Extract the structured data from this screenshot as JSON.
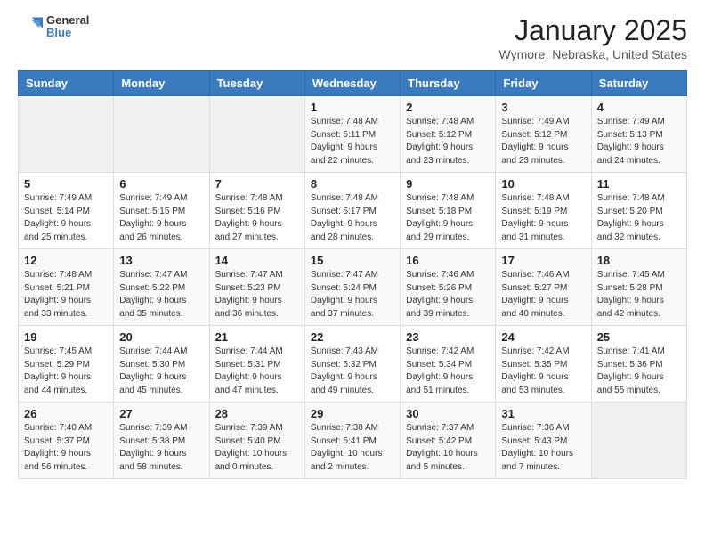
{
  "header": {
    "logo_line1": "General",
    "logo_line2": "Blue",
    "title": "January 2025",
    "subtitle": "Wymore, Nebraska, United States"
  },
  "weekdays": [
    "Sunday",
    "Monday",
    "Tuesday",
    "Wednesday",
    "Thursday",
    "Friday",
    "Saturday"
  ],
  "weeks": [
    [
      {
        "day": "",
        "info": ""
      },
      {
        "day": "",
        "info": ""
      },
      {
        "day": "",
        "info": ""
      },
      {
        "day": "1",
        "info": "Sunrise: 7:48 AM\nSunset: 5:11 PM\nDaylight: 9 hours and 22 minutes."
      },
      {
        "day": "2",
        "info": "Sunrise: 7:48 AM\nSunset: 5:12 PM\nDaylight: 9 hours and 23 minutes."
      },
      {
        "day": "3",
        "info": "Sunrise: 7:49 AM\nSunset: 5:12 PM\nDaylight: 9 hours and 23 minutes."
      },
      {
        "day": "4",
        "info": "Sunrise: 7:49 AM\nSunset: 5:13 PM\nDaylight: 9 hours and 24 minutes."
      }
    ],
    [
      {
        "day": "5",
        "info": "Sunrise: 7:49 AM\nSunset: 5:14 PM\nDaylight: 9 hours and 25 minutes."
      },
      {
        "day": "6",
        "info": "Sunrise: 7:49 AM\nSunset: 5:15 PM\nDaylight: 9 hours and 26 minutes."
      },
      {
        "day": "7",
        "info": "Sunrise: 7:48 AM\nSunset: 5:16 PM\nDaylight: 9 hours and 27 minutes."
      },
      {
        "day": "8",
        "info": "Sunrise: 7:48 AM\nSunset: 5:17 PM\nDaylight: 9 hours and 28 minutes."
      },
      {
        "day": "9",
        "info": "Sunrise: 7:48 AM\nSunset: 5:18 PM\nDaylight: 9 hours and 29 minutes."
      },
      {
        "day": "10",
        "info": "Sunrise: 7:48 AM\nSunset: 5:19 PM\nDaylight: 9 hours and 31 minutes."
      },
      {
        "day": "11",
        "info": "Sunrise: 7:48 AM\nSunset: 5:20 PM\nDaylight: 9 hours and 32 minutes."
      }
    ],
    [
      {
        "day": "12",
        "info": "Sunrise: 7:48 AM\nSunset: 5:21 PM\nDaylight: 9 hours and 33 minutes."
      },
      {
        "day": "13",
        "info": "Sunrise: 7:47 AM\nSunset: 5:22 PM\nDaylight: 9 hours and 35 minutes."
      },
      {
        "day": "14",
        "info": "Sunrise: 7:47 AM\nSunset: 5:23 PM\nDaylight: 9 hours and 36 minutes."
      },
      {
        "day": "15",
        "info": "Sunrise: 7:47 AM\nSunset: 5:24 PM\nDaylight: 9 hours and 37 minutes."
      },
      {
        "day": "16",
        "info": "Sunrise: 7:46 AM\nSunset: 5:26 PM\nDaylight: 9 hours and 39 minutes."
      },
      {
        "day": "17",
        "info": "Sunrise: 7:46 AM\nSunset: 5:27 PM\nDaylight: 9 hours and 40 minutes."
      },
      {
        "day": "18",
        "info": "Sunrise: 7:45 AM\nSunset: 5:28 PM\nDaylight: 9 hours and 42 minutes."
      }
    ],
    [
      {
        "day": "19",
        "info": "Sunrise: 7:45 AM\nSunset: 5:29 PM\nDaylight: 9 hours and 44 minutes."
      },
      {
        "day": "20",
        "info": "Sunrise: 7:44 AM\nSunset: 5:30 PM\nDaylight: 9 hours and 45 minutes."
      },
      {
        "day": "21",
        "info": "Sunrise: 7:44 AM\nSunset: 5:31 PM\nDaylight: 9 hours and 47 minutes."
      },
      {
        "day": "22",
        "info": "Sunrise: 7:43 AM\nSunset: 5:32 PM\nDaylight: 9 hours and 49 minutes."
      },
      {
        "day": "23",
        "info": "Sunrise: 7:42 AM\nSunset: 5:34 PM\nDaylight: 9 hours and 51 minutes."
      },
      {
        "day": "24",
        "info": "Sunrise: 7:42 AM\nSunset: 5:35 PM\nDaylight: 9 hours and 53 minutes."
      },
      {
        "day": "25",
        "info": "Sunrise: 7:41 AM\nSunset: 5:36 PM\nDaylight: 9 hours and 55 minutes."
      }
    ],
    [
      {
        "day": "26",
        "info": "Sunrise: 7:40 AM\nSunset: 5:37 PM\nDaylight: 9 hours and 56 minutes."
      },
      {
        "day": "27",
        "info": "Sunrise: 7:39 AM\nSunset: 5:38 PM\nDaylight: 9 hours and 58 minutes."
      },
      {
        "day": "28",
        "info": "Sunrise: 7:39 AM\nSunset: 5:40 PM\nDaylight: 10 hours and 0 minutes."
      },
      {
        "day": "29",
        "info": "Sunrise: 7:38 AM\nSunset: 5:41 PM\nDaylight: 10 hours and 2 minutes."
      },
      {
        "day": "30",
        "info": "Sunrise: 7:37 AM\nSunset: 5:42 PM\nDaylight: 10 hours and 5 minutes."
      },
      {
        "day": "31",
        "info": "Sunrise: 7:36 AM\nSunset: 5:43 PM\nDaylight: 10 hours and 7 minutes."
      },
      {
        "day": "",
        "info": ""
      }
    ]
  ]
}
